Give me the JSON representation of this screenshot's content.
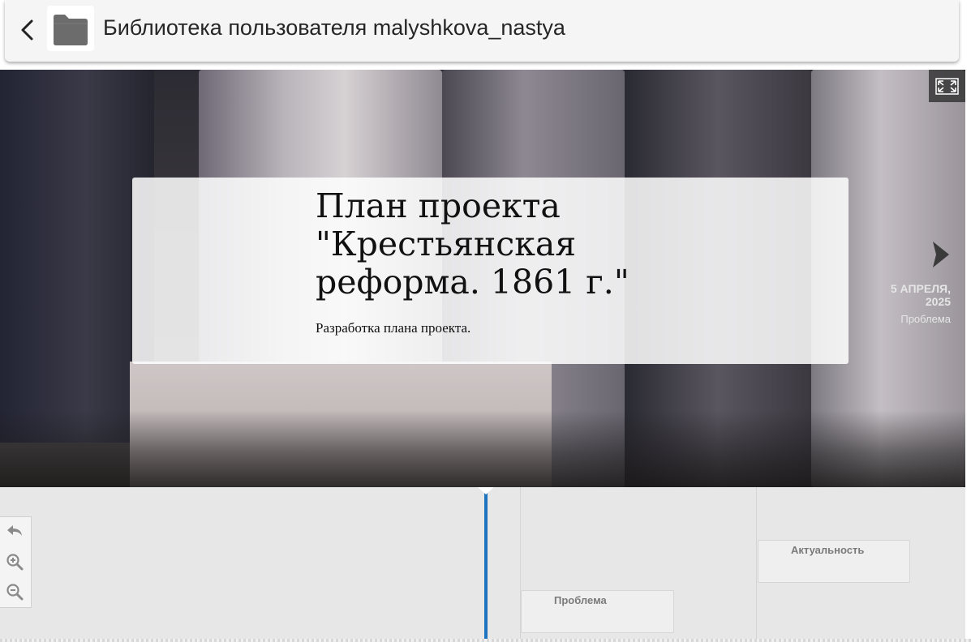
{
  "header": {
    "title": "Библиотека пользователя malyshkova_nastya",
    "back_icon": "chevron-left-icon",
    "folder_icon": "folder-icon"
  },
  "slide": {
    "headline": "План проекта \"Крестьянская реформа. 1861 г.\"",
    "text": "Разработка плана проекта.",
    "fullscreen_icon": "fullscreen-icon",
    "next": {
      "date_line1": "5 АПРЕЛЯ,",
      "date_line2": "2025",
      "title": "Проблема",
      "icon": "chevron-right-icon"
    }
  },
  "timeline": {
    "flags": [
      {
        "label": "Проблема"
      },
      {
        "label": "Актуальность"
      }
    ],
    "controls": {
      "back_icon": "undo-arrow-icon",
      "zoom_in_icon": "zoom-in-icon",
      "zoom_out_icon": "zoom-out-icon"
    }
  },
  "colors": {
    "marker": "#1e73be",
    "header_bg": "#f5f5f5",
    "timeline_bg": "#e7e7e7"
  }
}
